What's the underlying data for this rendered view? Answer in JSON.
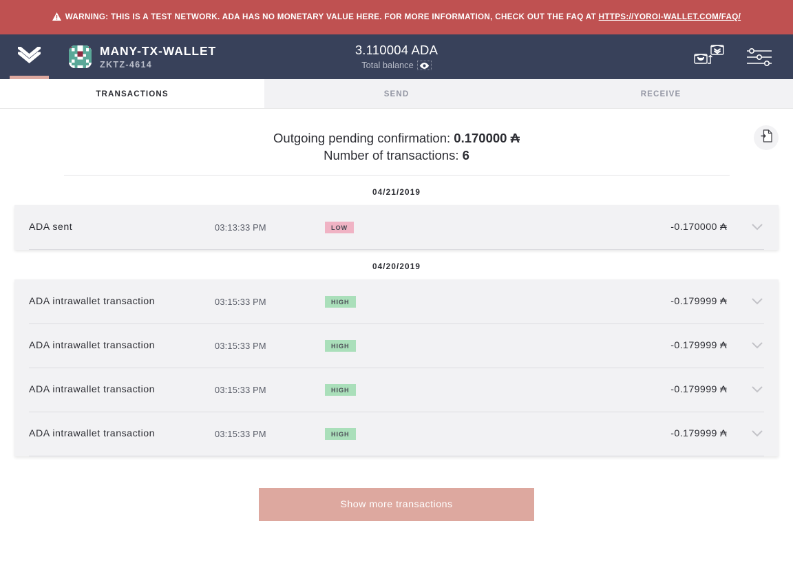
{
  "warning": {
    "icon": "warning-triangle-icon",
    "text_before": "WARNING: THIS IS A TEST NETWORK. ADA HAS NO MONETARY VALUE HERE. FOR MORE INFORMATION, CHECK OUT THE FAQ AT ",
    "link_text": "HTTPS://YOROI-WALLET.COM/FAQ/",
    "bg_color": "#bf5151"
  },
  "topnav": {
    "logo_icon": "yoroi-logo-icon",
    "wallet_name": "MANY-TX-WALLET",
    "wallet_plate": "ZKTZ-4614",
    "avatar_icon": "wallet-identicon-avatar",
    "balance_amount": "3.110004 ADA",
    "balance_label": "Total balance",
    "eye_icon": "eye-icon",
    "switch_wallet_icon": "switch-wallet-icon",
    "settings_icon": "settings-sliders-icon",
    "bg_color": "#38415a",
    "accent_color": "#dda89f"
  },
  "tabs": [
    {
      "label": "TRANSACTIONS",
      "active": true
    },
    {
      "label": "SEND",
      "active": false
    },
    {
      "label": "RECEIVE",
      "active": false
    }
  ],
  "summary": {
    "pending_label": "Outgoing pending confirmation: ",
    "pending_value": "0.170000 ₳",
    "count_label": "Number of transactions: ",
    "count_value": "6",
    "export_icon": "export-transactions-icon"
  },
  "groups": [
    {
      "date": "04/21/2019",
      "rows": [
        {
          "title": "ADA sent",
          "time": "03:13:33 PM",
          "badge": "LOW",
          "badge_type": "low",
          "amount": "-0.170000 ₳",
          "chevron_icon": "chevron-down-icon"
        }
      ]
    },
    {
      "date": "04/20/2019",
      "rows": [
        {
          "title": "ADA intrawallet transaction",
          "time": "03:15:33 PM",
          "badge": "HIGH",
          "badge_type": "high",
          "amount": "-0.179999 ₳",
          "chevron_icon": "chevron-down-icon"
        },
        {
          "title": "ADA intrawallet transaction",
          "time": "03:15:33 PM",
          "badge": "HIGH",
          "badge_type": "high",
          "amount": "-0.179999 ₳",
          "chevron_icon": "chevron-down-icon"
        },
        {
          "title": "ADA intrawallet transaction",
          "time": "03:15:33 PM",
          "badge": "HIGH",
          "badge_type": "high",
          "amount": "-0.179999 ₳",
          "chevron_icon": "chevron-down-icon"
        },
        {
          "title": "ADA intrawallet transaction",
          "time": "03:15:33 PM",
          "badge": "HIGH",
          "badge_type": "high",
          "amount": "-0.179999 ₳",
          "chevron_icon": "chevron-down-icon"
        }
      ]
    }
  ],
  "footer": {
    "show_more_label": "Show more transactions",
    "button_color": "#dda89f"
  }
}
